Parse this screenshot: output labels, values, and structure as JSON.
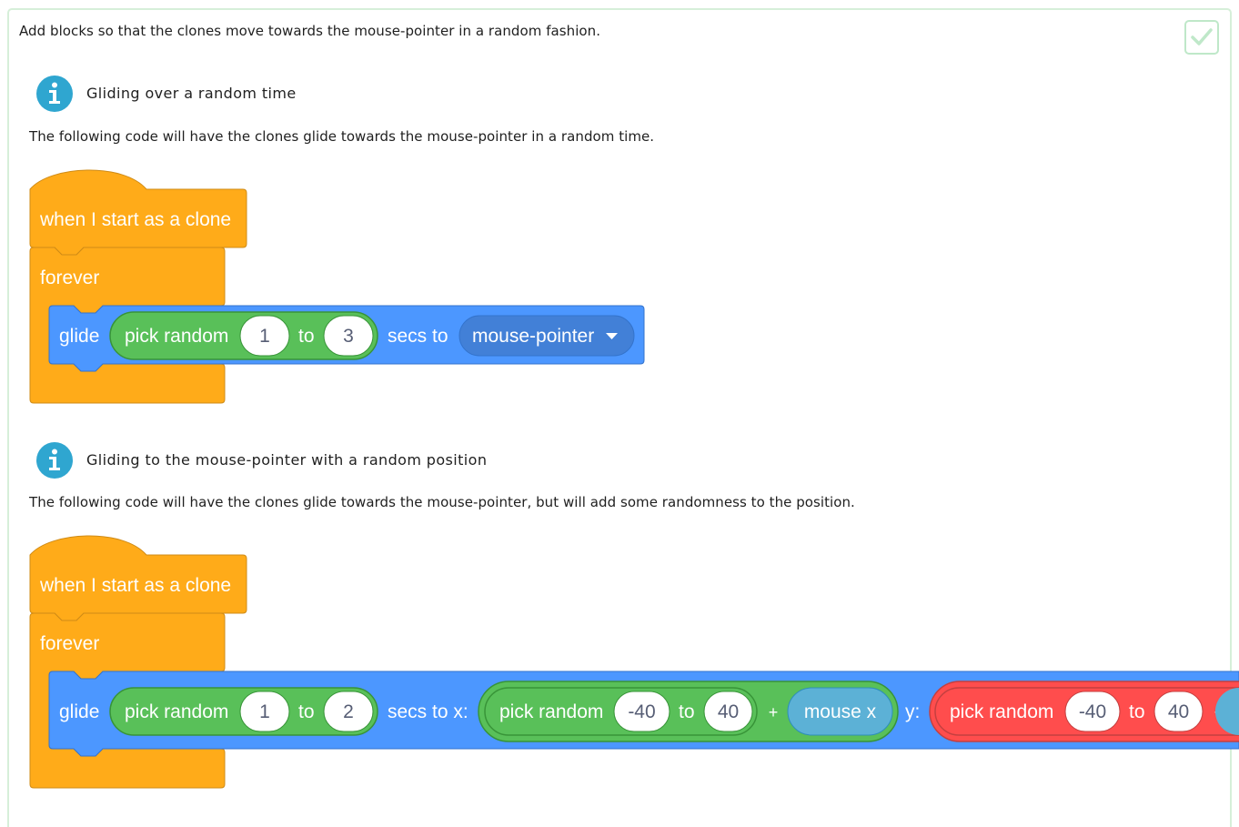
{
  "task": {
    "text": "Add blocks so that the clones move towards the mouse-pointer in a random fashion."
  },
  "sections": [
    {
      "title": "Gliding over a random time",
      "description": "The following code will have the clones glide towards the mouse-pointer in a random time.",
      "script": {
        "hat": "when I start as a clone",
        "forever": "forever",
        "glide": "glide",
        "pick_random": "pick random",
        "from": "1",
        "to_label": "to",
        "to": "3",
        "secs_to": "secs to",
        "target": "mouse-pointer"
      }
    },
    {
      "title": "Gliding to the mouse-pointer with a random position",
      "description": "The following code will have the clones glide towards the mouse-pointer, but will add some randomness to the position.",
      "script": {
        "hat": "when I start as a clone",
        "forever": "forever",
        "glide": "glide",
        "pick_random": "pick random",
        "from": "1",
        "to_label": "to",
        "to": "2",
        "secs_to_x": "secs to x:",
        "x_pick_random": "pick random",
        "x_from": "-40",
        "x_to_label": "to",
        "x_to": "40",
        "plus": "+",
        "mouse_x": "mouse x",
        "y_label": "y:",
        "y_pick_random": "pick random",
        "y_from": "-40",
        "y_to_label": "to",
        "y_to": "40",
        "y_plus": "+"
      }
    }
  ],
  "colors": {
    "events": "#ffab19",
    "control": "#ffab19",
    "motion": "#4c97ff",
    "motion_menu": "#4280d7",
    "operators": "#59c059",
    "operators_alt": "#ff4d4d",
    "sensing": "#5cb1d6",
    "info": "#2fa6d0",
    "check": "#bfe8c9"
  }
}
